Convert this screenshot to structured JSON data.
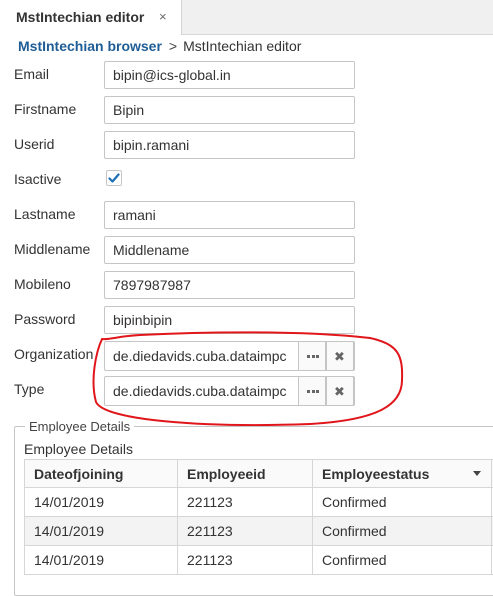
{
  "tab": {
    "title": "MstIntechian editor",
    "close_glyph": "×"
  },
  "breadcrumb": {
    "parent": "MstIntechian browser",
    "separator": ">",
    "current": "MstIntechian editor"
  },
  "form": {
    "email": {
      "label": "Email",
      "value": "bipin@ics-global.in"
    },
    "firstname": {
      "label": "Firstname",
      "value": "Bipin"
    },
    "userid": {
      "label": "Userid",
      "value": "bipin.ramani"
    },
    "isactive": {
      "label": "Isactive",
      "checked": true
    },
    "lastname": {
      "label": "Lastname",
      "value": "ramani"
    },
    "middlename": {
      "label": "Middlename",
      "placeholder": "Middlename"
    },
    "mobileno": {
      "label": "Mobileno",
      "value": "7897987987"
    },
    "password": {
      "label": "Password",
      "value": "bipinbipin"
    },
    "organization": {
      "label": "Organization",
      "value": "de.diedavids.cuba.dataimpc"
    },
    "type": {
      "label": "Type",
      "value": "de.diedavids.cuba.dataimpc"
    }
  },
  "annotation": {
    "color": "#e0161b",
    "shape": "hand-drawn ellipse around Organization and Type pickers"
  },
  "employee_details": {
    "group_caption": "Employee Details",
    "table_caption": "Employee Details",
    "columns": [
      "Dateofjoining",
      "Employeeid",
      "Employeestatus"
    ],
    "rows": [
      [
        "14/01/2019",
        "221123",
        "Confirmed"
      ],
      [
        "14/01/2019",
        "221123",
        "Confirmed"
      ],
      [
        "14/01/2019",
        "221123",
        "Confirmed"
      ]
    ]
  },
  "colors": {
    "link": "#1f5d96",
    "checkmark": "#1f6fb5",
    "border": "#c5c5c5",
    "row_alt": "#f3f3f3"
  },
  "icons": [
    "close-icon",
    "checkmark-icon",
    "lookup-dots-icon",
    "clear-x-icon",
    "sort-down-icon"
  ]
}
